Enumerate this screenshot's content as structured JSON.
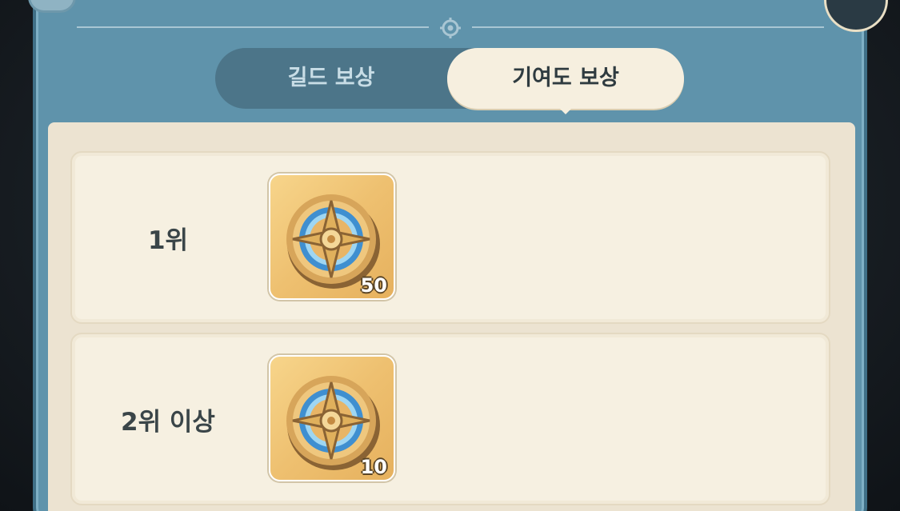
{
  "tabs": {
    "guild_reward": "길드 보상",
    "contribution_reward": "기여도 보상"
  },
  "rewards": [
    {
      "rank": "1위",
      "item_icon": "compass-medal-icon",
      "quantity": "50"
    },
    {
      "rank": "2위 이상",
      "item_icon": "compass-medal-icon",
      "quantity": "10"
    }
  ],
  "colors": {
    "panel": "#5f93ab",
    "tab_active_bg": "#f6efdf",
    "row_bg": "#f6f0e1",
    "item_bg": "#eec070"
  }
}
